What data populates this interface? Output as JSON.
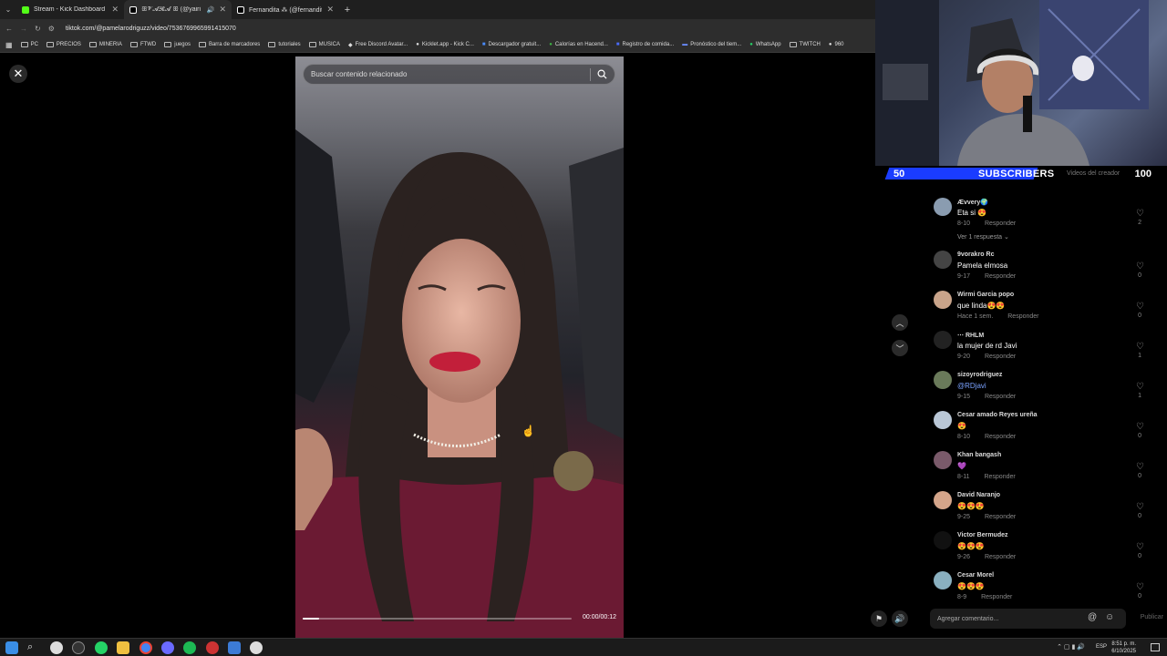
{
  "browser": {
    "tabs": [
      {
        "label": "Stream - Kick Dashboard",
        "color": "#53fc18",
        "active": false
      },
      {
        "label": "ꕥ𝓥𝓐𝓡𝓐 ꕥ (@yairi",
        "color": "#ffffff",
        "active": true
      },
      {
        "label": "Fernandita ⁂ (@fernanditacg",
        "color": "#ffffff",
        "active": false
      }
    ],
    "url": "tiktok.com/@pamelarodriguzz/video/7536769965991415070",
    "bookmarks": [
      "PC",
      "PRECIOS",
      "MINERIA",
      "FTWD",
      "juegos",
      "Barra de marcadores",
      "tutoriales",
      "MUSICA",
      "Free Discord Avatar...",
      "Kicklet.app - Kick C...",
      "Descargador gratuit...",
      "Calorías en Hacend...",
      "Registro de comida...",
      "Pronóstico del tiem...",
      "WhatsApp",
      "TWITCH",
      "960"
    ]
  },
  "video": {
    "search_placeholder": "Buscar contenido relacionado",
    "time": "00:00/00:12",
    "progress": 0.06
  },
  "subs": {
    "start": "50",
    "label": "SUBSCRIBERS",
    "goal": "100",
    "current_fraction": 0.5,
    "creator_videos": "Videos del creador"
  },
  "comments": [
    {
      "name": "Ævvery🌍",
      "text": "Eta si 😍",
      "date": "8-10",
      "reply": "Responder",
      "likes": "2",
      "replies": "Ver 1 respuesta ⌄",
      "avatar": "#8a9cb0"
    },
    {
      "name": "9vorakro Rc",
      "text": "Pamela elmosa",
      "date": "9-17",
      "reply": "Responder",
      "likes": "0",
      "avatar": "#444"
    },
    {
      "name": "Wirmi Garcia popo",
      "text": "que linda😍😍",
      "date": "Hace 1 sem.",
      "reply": "Responder",
      "likes": "0",
      "avatar": "#c9a48a"
    },
    {
      "name": "⋯ RHLM",
      "text": "la mujer de rd Javi",
      "date": "9-20",
      "reply": "Responder",
      "likes": "1",
      "avatar": "#222"
    },
    {
      "name": "sizoyrodriguez",
      "text": "@RDjavi",
      "date": "9-15",
      "reply": "Responder",
      "likes": "1",
      "avatar": "#6a7a5a",
      "mention": true
    },
    {
      "name": "Cesar amado Reyes ureña",
      "text": "😍",
      "date": "8-10",
      "reply": "Responder",
      "likes": "0",
      "avatar": "#b9c7d6"
    },
    {
      "name": "Khan bangash",
      "text": "💜",
      "date": "8-11",
      "reply": "Responder",
      "likes": "0",
      "avatar": "#7a5a6a"
    },
    {
      "name": "David Naranjo",
      "text": "😍😍😍",
      "date": "9-25",
      "reply": "Responder",
      "likes": "0",
      "avatar": "#d4a58a"
    },
    {
      "name": "Victor Bermudez",
      "text": "😍😍😍",
      "date": "9-26",
      "reply": "Responder",
      "likes": "0",
      "avatar": "#111"
    },
    {
      "name": "Cesar Morel",
      "text": "😍😍😍",
      "date": "8-9",
      "reply": "Responder",
      "likes": "0",
      "avatar": "#8ab0c0"
    }
  ],
  "comment_bar": {
    "placeholder": "Agregar comentario...",
    "publish": "Publicar"
  },
  "taskbar": {
    "time": "8:51 p. m.",
    "date": "6/10/2025",
    "lang": "ESP"
  }
}
